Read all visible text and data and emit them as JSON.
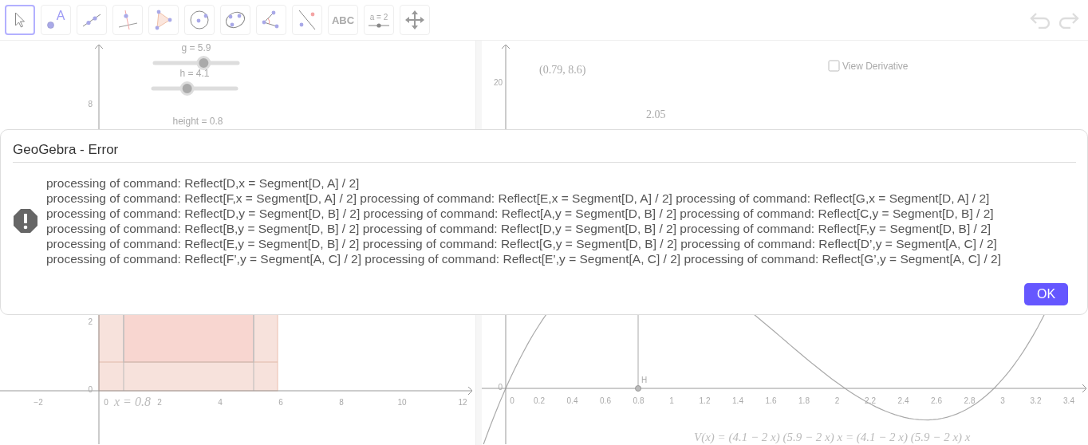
{
  "toolbar": {
    "tools": [
      {
        "kind": "move",
        "selected": true
      },
      {
        "kind": "point",
        "label": "A",
        "selected": false
      },
      {
        "kind": "line",
        "selected": false
      },
      {
        "kind": "perpendicular",
        "selected": false
      },
      {
        "kind": "polygon",
        "selected": false
      },
      {
        "kind": "circle",
        "selected": false
      },
      {
        "kind": "conic",
        "selected": false
      },
      {
        "kind": "angle",
        "selected": false
      },
      {
        "kind": "reflect",
        "selected": false
      },
      {
        "kind": "text",
        "label": "ABC",
        "selected": false
      },
      {
        "kind": "slider",
        "label": "a = 2",
        "selected": false
      },
      {
        "kind": "move-view",
        "selected": false
      }
    ]
  },
  "left_graphics": {
    "sliders": [
      {
        "label": "g = 5.9",
        "level": 0.59
      },
      {
        "label": "h = 4.1",
        "level": 0.41
      },
      {
        "label": "height = 0.8"
      }
    ],
    "y_axis_labels": [
      "8",
      "2",
      "0"
    ],
    "x_axis_labels": [
      "−2",
      "0",
      "2",
      "4",
      "6",
      "8",
      "10",
      "12"
    ],
    "line_label": "x = 0.8"
  },
  "right_graphics": {
    "point_coordinates": "(0.79, 8.6)",
    "value_label": "2.05",
    "view_derivative": {
      "label": "View Derivative",
      "checked": false
    },
    "y_axis_labels": [
      "20",
      "0"
    ],
    "x_axis_labels": [
      "0",
      "0.2",
      "0.4",
      "0.6",
      "0.8",
      "1",
      "1.2",
      "1.4",
      "1.6",
      "1.8",
      "2",
      "2.2",
      "2.4",
      "2.6",
      "2.8",
      "3",
      "3.2",
      "3.4"
    ],
    "point_label": "H",
    "function_label": "V(x) = (4.1 − 2 x)  (5.9 − 2 x)  x = (4.1 − 2 x)  (5.9 − 2 x)  x"
  },
  "dialog": {
    "title": "GeoGebra - Error",
    "message_lines": [
      "processing of command: Reflect[D,x = Segment[D, A] / 2]",
      "processing of command: Reflect[F,x = Segment[D, A] / 2] processing of command: Reflect[E,x = Segment[D, A] / 2] processing of command: Reflect[G,x = Segment[D, A] / 2]",
      "processing of command: Reflect[D,y = Segment[D, B] / 2] processing of command: Reflect[A,y = Segment[D, B] / 2] processing of command: Reflect[C,y = Segment[D, B] / 2]",
      "processing of command: Reflect[B,y = Segment[D, B] / 2] processing of command: Reflect[D,y = Segment[D, B] / 2] processing of command: Reflect[F,y = Segment[D, B] / 2]",
      "processing of command: Reflect[E,y = Segment[D, B] / 2] processing of command: Reflect[G,y = Segment[D, B] / 2] processing of command: Reflect[D’,y = Segment[A, C] / 2]",
      "processing of command: Reflect[F’,y = Segment[A, C] / 2] processing of command: Reflect[E’,y = Segment[A, C] / 2] processing of command: Reflect[G’,y = Segment[A, C] / 2]"
    ],
    "button": "OK"
  }
}
